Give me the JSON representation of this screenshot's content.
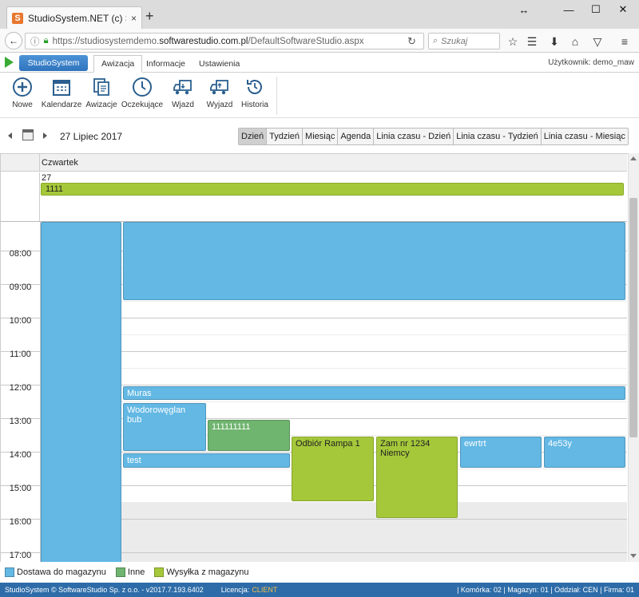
{
  "browser": {
    "tab_title": "StudioSystem.NET (c) Softw",
    "url_prefix": "https://studiosystemdemo.",
    "url_domain": "softwarestudio.com.pl",
    "url_path": "/DefaultSoftwareStudio.aspx",
    "search_placeholder": "Szukaj",
    "new_tab": "+",
    "close_tab": "×"
  },
  "app": {
    "brand": "StudioSystem",
    "tabs": [
      {
        "label": "Awizacja",
        "active": true
      },
      {
        "label": "Informacje",
        "active": false
      },
      {
        "label": "Ustawienia",
        "active": false
      }
    ],
    "user": "Użytkownik: demo_maw"
  },
  "ribbon": {
    "buttons": [
      {
        "label": "Nowe",
        "icon": "plus-circle-icon"
      },
      {
        "label": "Kalendarze",
        "icon": "calendar-icon"
      },
      {
        "label": "Awizacje",
        "icon": "documents-icon"
      },
      {
        "label": "Oczekujące",
        "icon": "clock-icon"
      },
      {
        "label": "Wjazd",
        "icon": "truck-in-icon"
      },
      {
        "label": "Wyjazd",
        "icon": "truck-out-icon"
      },
      {
        "label": "Historia",
        "icon": "history-icon"
      }
    ]
  },
  "datenav": {
    "title": "27 Lipiec 2017",
    "views": [
      {
        "label": "Dzień",
        "active": true
      },
      {
        "label": "Tydzień",
        "active": false
      },
      {
        "label": "Miesiąc",
        "active": false
      },
      {
        "label": "Agenda",
        "active": false
      },
      {
        "label": "Linia czasu - Dzień",
        "active": false
      },
      {
        "label": "Linia czasu - Tydzień",
        "active": false
      },
      {
        "label": "Linia czasu - Miesiąc",
        "active": false
      }
    ]
  },
  "scheduler": {
    "day_name": "Czwartek",
    "day_number": "27",
    "all_day_event": "1111",
    "hours": [
      "08:00",
      "09:00",
      "10:00",
      "11:00",
      "12:00",
      "13:00",
      "14:00",
      "15:00",
      "16:00",
      "17:00"
    ],
    "events": [
      {
        "title": "",
        "category": "blue"
      },
      {
        "title": "",
        "category": "blue"
      },
      {
        "title": "Muras",
        "category": "blue"
      },
      {
        "title": "Wodorowęglan bub",
        "category": "blue"
      },
      {
        "title": "111111111",
        "category": "green"
      },
      {
        "title": "test",
        "category": "blue"
      },
      {
        "title": "Odbiór Rampa 1",
        "category": "lime"
      },
      {
        "title": "Zam nr 1234 Niemcy",
        "category": "lime"
      },
      {
        "title": "ewrtrt",
        "category": "blue"
      },
      {
        "title": "4e53y",
        "category": "blue"
      }
    ]
  },
  "legend": [
    {
      "label": "Dostawa do magazynu",
      "color": "#63b8e4"
    },
    {
      "label": "Inne",
      "color": "#6fb46f"
    },
    {
      "label": "Wysyłka z magazynu",
      "color": "#a5c83a"
    }
  ],
  "status": {
    "copyright": "StudioSystem © SoftwareStudio Sp. z o.o. - v2017.7.193.6402",
    "license_label": "Licencja:",
    "license_value": "CLIENT",
    "right": "| Komórka: 02 | Magazyn: 01 | Oddział: CEN | Firma: 01"
  }
}
